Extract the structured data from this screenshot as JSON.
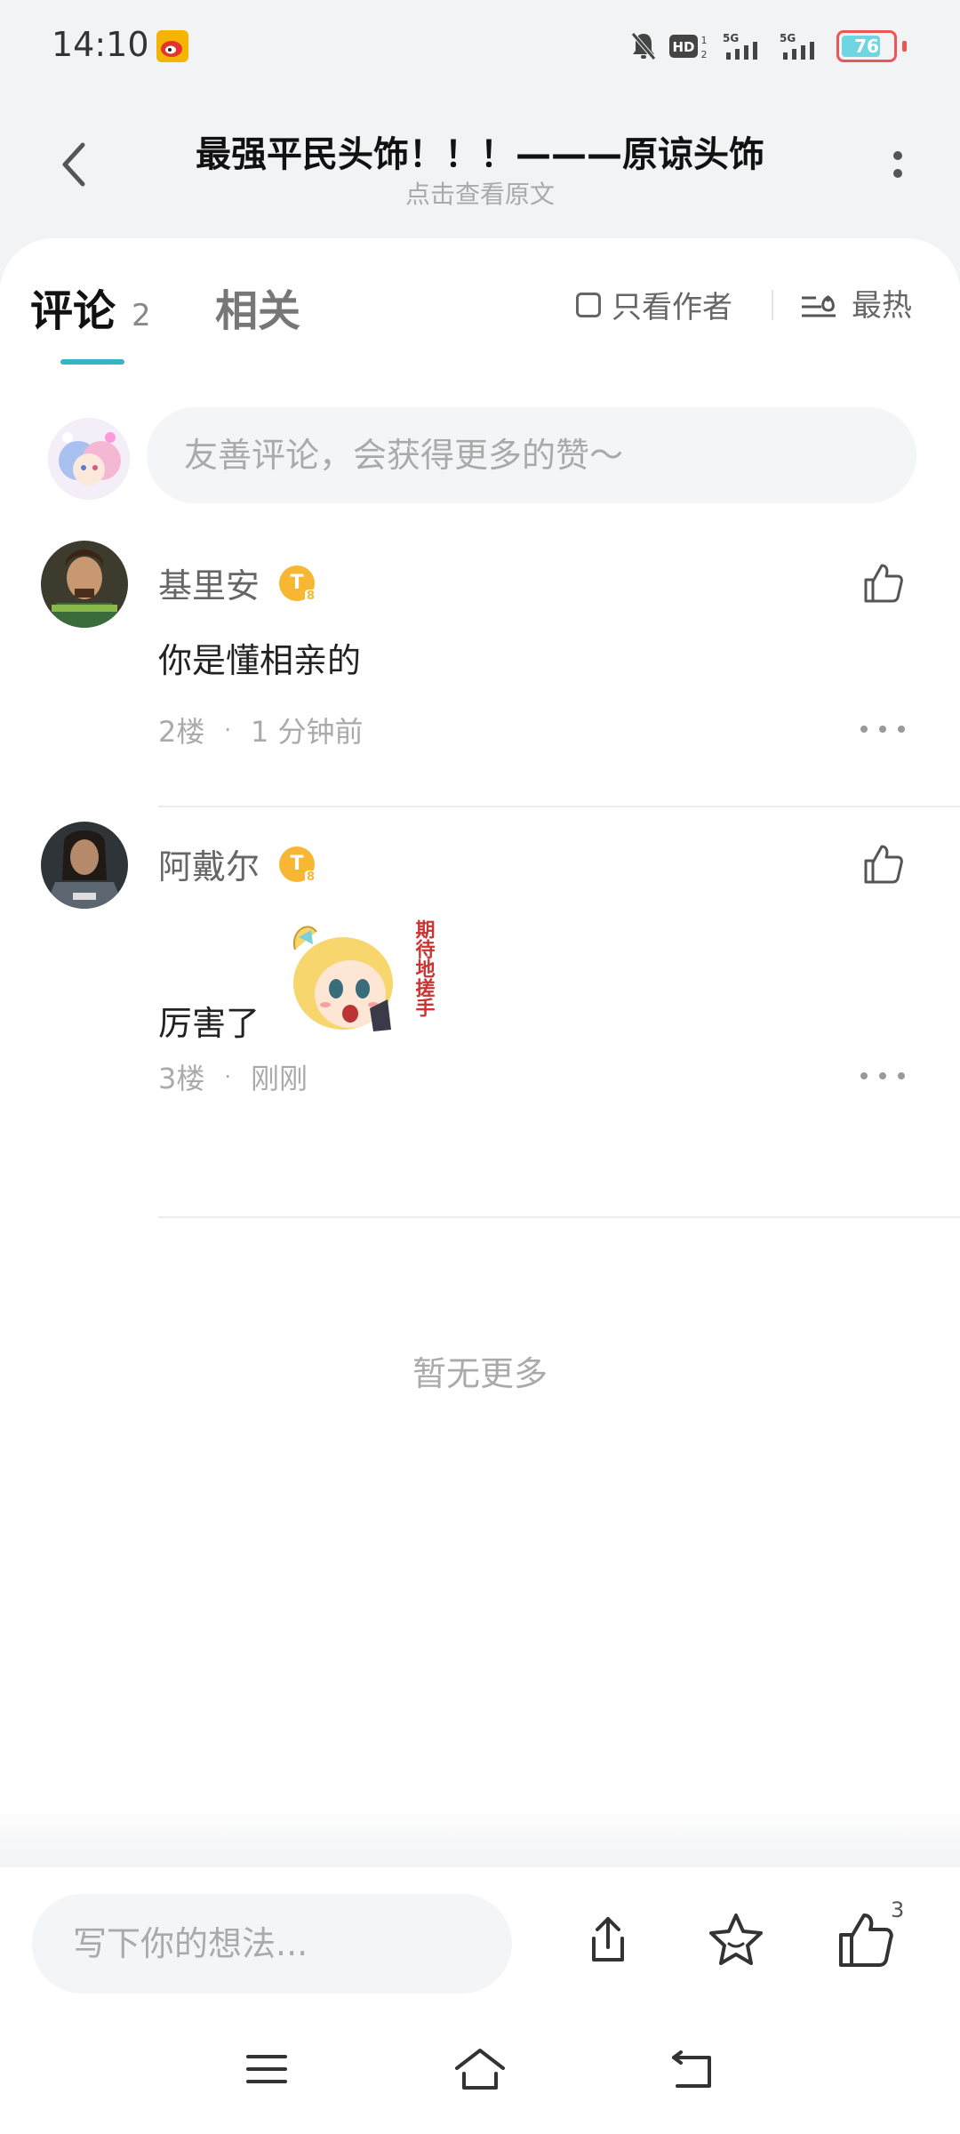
{
  "status": {
    "time": "14:10",
    "battery": "76",
    "battery_level": 0.76,
    "network": "5G"
  },
  "header": {
    "title": "最强平民头饰！！！———原谅头饰",
    "subtitle": "点击查看原文"
  },
  "tabs": {
    "comments_label": "评论",
    "comments_count": "2",
    "related_label": "相关",
    "author_only": "只看作者",
    "sort_label": "最热"
  },
  "compose": {
    "placeholder": "友善评论，会获得更多的赞～"
  },
  "comments": [
    {
      "name": "基里安",
      "badge": "T",
      "badge_level": "8",
      "text": "你是懂相亲的",
      "floor": "2楼",
      "time": "1 分钟前"
    },
    {
      "name": "阿戴尔",
      "badge": "T",
      "badge_level": "8",
      "text": "厉害了",
      "floor": "3楼",
      "time": "刚刚",
      "sticker_text": "期待地搓手"
    }
  ],
  "footer": {
    "no_more": "暂无更多"
  },
  "bottom_bar": {
    "placeholder": "写下你的想法...",
    "like_count": "3"
  },
  "colors": {
    "accent": "#35b6c4",
    "badge": "#f7b733",
    "background": "#f2f3f5"
  }
}
